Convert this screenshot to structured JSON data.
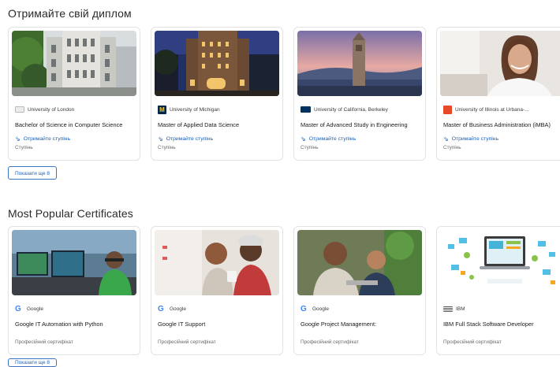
{
  "degrees": {
    "title": "Отримайте свій диплом",
    "more_label": "Показати ще 8",
    "cards": [
      {
        "partner": "University of London",
        "title": "Bachelor of Science in Computer Science",
        "earn": "Отримайте ступінь",
        "type": "Ступінь",
        "logo_color": "#c8c8c8",
        "logo": "university-of-london-logo"
      },
      {
        "partner": "University of Michigan",
        "title": "Master of Applied Data Science",
        "earn": "Отримайте ступінь",
        "type": "Ступінь",
        "logo_color": "#00274c",
        "logo": "michigan-logo"
      },
      {
        "partner": "University of California, Berkeley",
        "title": "Master of Advanced Study in Engineering",
        "earn": "Отримайте ступінь",
        "type": "Ступінь",
        "logo_color": "#003262",
        "logo": "berkeley-logo"
      },
      {
        "partner": "University of Illinois at Urbana-...",
        "title": "Master of Business Administration (iMBA)",
        "earn": "Отримайте ступінь",
        "type": "Ступінь",
        "logo_color": "#e84a27",
        "logo": "illinois-logo"
      }
    ]
  },
  "certificates": {
    "title": "Most Popular Certificates",
    "more_label": "Показати ще 8",
    "cards": [
      {
        "partner": "Google",
        "title": "Google IT Automation with Python",
        "type": "Професійний сертифікат",
        "logo": "google-logo"
      },
      {
        "partner": "Google",
        "title": "Google IT Support",
        "type": "Професійний сертифікат",
        "logo": "google-logo"
      },
      {
        "partner": "Google",
        "title": "Google Project Management:",
        "type": "Професійний сертифікат",
        "logo": "google-logo"
      },
      {
        "partner": "IBM",
        "title": "IBM Full Stack Software Developer",
        "type": "Професійний сертифікат",
        "logo": "ibm-logo"
      }
    ]
  }
}
